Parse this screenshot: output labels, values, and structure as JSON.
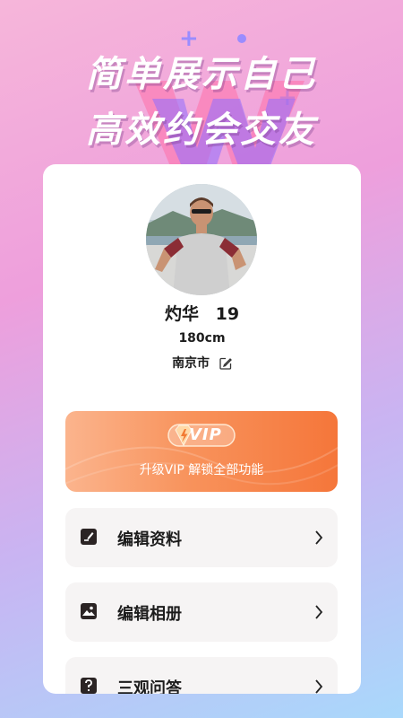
{
  "headline": {
    "line1": "简单展示自己",
    "line2": "高效约会交友"
  },
  "profile": {
    "name": "灼华",
    "age": "19",
    "height": "180cm",
    "city": "南京市"
  },
  "vip": {
    "badge": "VIP",
    "subtitle": "升级VIP 解锁全部功能"
  },
  "menu": [
    {
      "label": "编辑资料",
      "icon": "edit-document-icon"
    },
    {
      "label": "编辑相册",
      "icon": "photo-album-icon"
    },
    {
      "label": "三观问答",
      "icon": "question-icon"
    }
  ],
  "colors": {
    "vip_gradient_start": "#fbb48d",
    "vip_gradient_end": "#f5763a",
    "accent_purple": "#9a8cff",
    "menu_bg": "#f6f4f4"
  }
}
